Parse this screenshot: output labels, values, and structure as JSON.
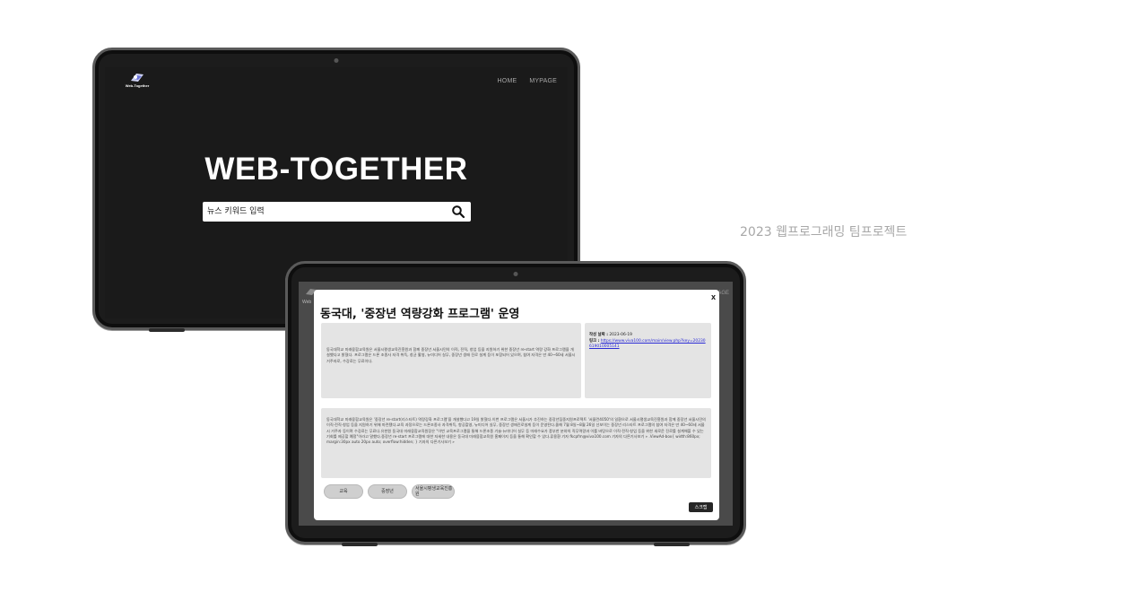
{
  "tablet1": {
    "logo_text": "Web-Together",
    "nav": {
      "home": "HOME",
      "mypage": "MYPAGE"
    },
    "hero_title": "WEB-TOGETHER",
    "search": {
      "placeholder": "뉴스 키워드 입력",
      "icon": "search-icon"
    }
  },
  "caption": "2023 웹프로그래밍 팀프로젝트",
  "tablet2": {
    "behind_logo_text": "Web",
    "behind_nav": "AGE",
    "modal": {
      "close_label": "x",
      "title": "동국대, '중장년 역량강화 프로그램' 운영",
      "summary": "동국대학교 미래융합교육원은 서울시평생교육진흥원과 함께 중장년 서울시민의 이직, 전직, 창업 등을 지원하기 위한 중장년 re-start 역량 강화 프로그램을 개설했다고 밝혔다. 프로그램은 드론 조종사 자격 취득, 창균 활영, 뉴미디어 실무, 중장년 생애 진로 설계 등이 포함되어 있으며, 참여 자격은 만 40~60세 서울시 거주자로, 수강료는 무료이다.",
      "date_label": "작성 날짜 :",
      "date_value": "2023-06-19",
      "link_label": "링크 :",
      "link_value": "https://www.viva100.com/main/view.php?key=20230619010005141",
      "body": "동국대학교 미래융합교육원은 '중장년 re-start(리스타트) 역량강화 프로그램'을 개설했다고 19일 밝혔다.이번 프로그램은 서울시가 추진하는 중장년집중지원프로젝트 '서울런4050'의 일환으로 서울시평생교육진흥원과 함께 중장년 서울시민의 이직·전직·창업 등을 지원하기 위해 마련됐다.교육 과정으로는 드론조종사 자격취득, 항공촬영, 뉴미디어 실무, 중장년 생애진로설계 등이 운영된다.올해 7월 8일~8월 26일 선보이는 중장년 리스타트 프로그램의 참여 자격은 만 40~60세 서울시 거주자 등이며 수강료는 무료다.유한원 동국대 미래융합교육원장은 \"이번 교육프로그램을 통해 드론조종 기술·뉴미디어 실무 등 미래수요가 풍부한 분야의 직무역량과 이를 바탕으로 이직·전직·창업 등을 위한 새로운 진로를 설계해볼 수 있는 기회를 제공할 예정\"이라고 말했다.중장년 re-start 프로그램에 대한 자세한 내용은 동국대 미래융합교육원 홈페이지 등을 통해 확인할 수 있다.류용환 기자 fkcpfm@viva100.com 기자의 다른기사보기 » .ViewAd-box{ width:860px; margin:30px auto 20px auto; overflow:hidden; } 기자의 다른기사보기 »",
      "tags": [
        "교육",
        "중장년",
        "서울시평생교육진흥원"
      ],
      "scrap_label": "스크랩"
    }
  }
}
